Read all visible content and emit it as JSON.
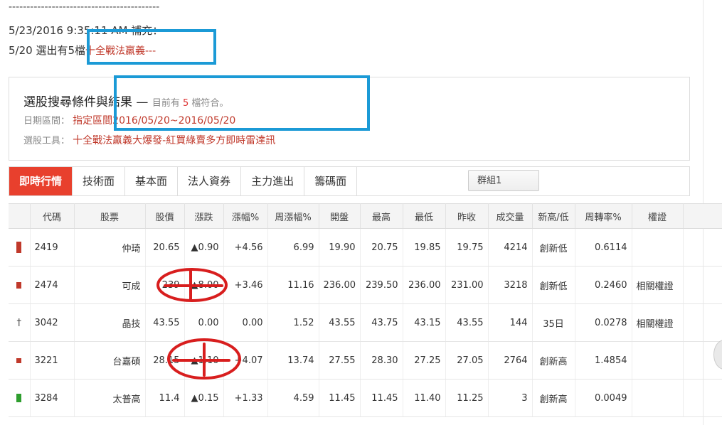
{
  "note": {
    "dashes": "------------------------------------------",
    "timestamp_line": "5/23/2016 9:35:11 AM 補充：",
    "selection_prefix": "5/20  選出有5檔",
    "selection_red": "十全戰法羸義---"
  },
  "panel": {
    "title": "選股搜尋條件與結果",
    "dash": "—",
    "count_prefix": "目前有",
    "count": "5",
    "count_suffix": "檔符合。",
    "date_label": "日期區間：",
    "date_value": "指定區間2016/05/20~2016/05/20",
    "tool_label": "選股工具：",
    "tool_value": "十全戰法羸義大爆發-紅買綠賣多方即時雷達訊"
  },
  "tabs": [
    {
      "label": "即時行情",
      "active": true
    },
    {
      "label": "技術面",
      "active": false
    },
    {
      "label": "基本面",
      "active": false
    },
    {
      "label": "法人資券",
      "active": false
    },
    {
      "label": "主力進出",
      "active": false
    },
    {
      "label": "籌碼面",
      "active": false
    }
  ],
  "group_button": "群組1",
  "table": {
    "headers": [
      "",
      "代碼",
      "股票",
      "股價",
      "漲跌",
      "漲幅%",
      "周漲幅%",
      "開盤",
      "最高",
      "最低",
      "昨收",
      "成交量",
      "新高/低",
      "周轉率%",
      "權證",
      ""
    ],
    "rows": [
      {
        "indicator": "red-tall",
        "code": "2419",
        "name": "仲琦",
        "price": "20.65",
        "change": "▲0.90",
        "pct": "+4.56",
        "week_pct": "6.99",
        "open": "19.90",
        "high": "20.75",
        "low": "19.85",
        "prev": "19.75",
        "volume": "4214",
        "hilo": "創新低",
        "turnover": "0.6114",
        "warrant": ""
      },
      {
        "indicator": "red-short",
        "code": "2474",
        "name": "可成",
        "price": "239",
        "change": "▲8.00",
        "pct": "+3.46",
        "week_pct": "11.16",
        "open": "236.00",
        "high": "239.50",
        "low": "236.00",
        "prev": "231.00",
        "volume": "3218",
        "hilo": "創新低",
        "turnover": "0.2460",
        "warrant": "相關權證"
      },
      {
        "indicator": "cross",
        "code": "3042",
        "name": "晶技",
        "price": "43.55",
        "change": "0.00",
        "pct": "0.00",
        "week_pct": "1.52",
        "open": "43.55",
        "high": "43.75",
        "low": "43.15",
        "prev": "43.55",
        "volume": "144",
        "hilo": "35日",
        "turnover": "0.0278",
        "warrant": "相關權證"
      },
      {
        "indicator": "red-small",
        "code": "3221",
        "name": "台嘉碩",
        "price": "28.15",
        "change": "▲1.10",
        "pct": "+4.07",
        "week_pct": "13.74",
        "open": "27.55",
        "high": "28.30",
        "low": "27.25",
        "prev": "27.05",
        "volume": "2764",
        "hilo": "創新高",
        "turnover": "1.4854",
        "warrant": ""
      },
      {
        "indicator": "green",
        "code": "3284",
        "name": "太普高",
        "price": "11.4",
        "change": "▲0.15",
        "pct": "+1.33",
        "week_pct": "4.59",
        "open": "11.45",
        "high": "11.45",
        "low": "11.40",
        "prev": "11.25",
        "volume": "3",
        "hilo": "創新高",
        "turnover": "0.0049",
        "warrant": ""
      }
    ]
  },
  "colors": {
    "accent": "#e8402d",
    "highlight_box": "#1b9ad6",
    "red_mark": "#d81e1e",
    "up": "#c0392b",
    "down": "#3a9a2e"
  }
}
